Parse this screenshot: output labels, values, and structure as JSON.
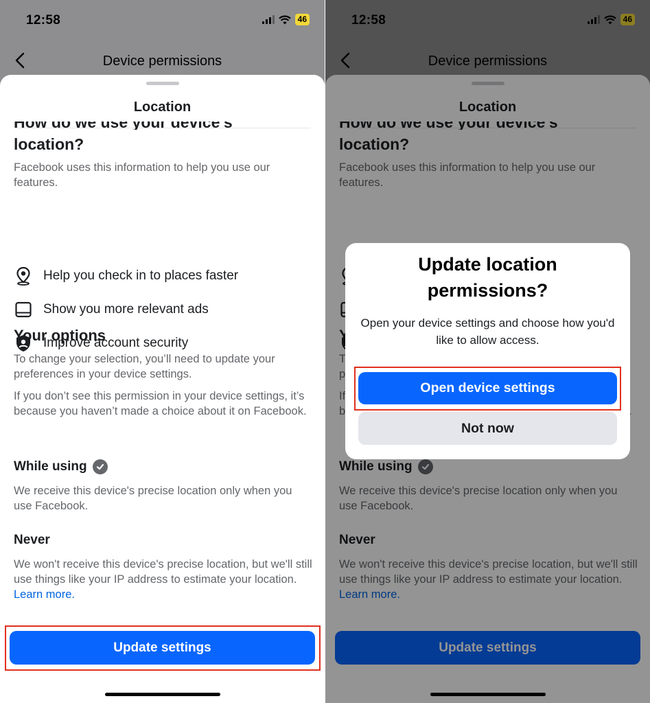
{
  "status": {
    "time": "12:58",
    "battery": "46"
  },
  "nav": {
    "title": "Device permissions"
  },
  "sheet": {
    "title": "Location",
    "cut_heading": "How do we use your device's",
    "heading": "location?",
    "intro": "Facebook uses this information to help you use our features.",
    "features": [
      {
        "icon": "location-pin-icon",
        "label": "Help you check in to places faster"
      },
      {
        "icon": "device-screen-icon",
        "label": "Show you more relevant ads"
      },
      {
        "icon": "shield-account-icon",
        "label": "Improve account security"
      }
    ],
    "options_heading": "Your options",
    "options_p1": "To change your selection, you’ll need to update your preferences in your device settings.",
    "options_p2": "If you don’t see this permission in your device settings, it’s because you haven’t made a choice about it on Facebook.",
    "while_using_heading": "While using",
    "while_using_text": "We receive this device's precise location only when you use Facebook.",
    "never_heading": "Never",
    "never_text": "We won't receive this device's precise location, but we'll still use things like your IP address to estimate your location.",
    "learn_more": "Learn more.",
    "update_button": "Update settings"
  },
  "dialog": {
    "title": "Update location permissions?",
    "text": "Open your device settings and choose how you'd like to allow access.",
    "primary": "Open device settings",
    "secondary": "Not now"
  },
  "colors": {
    "primary_blue": "#0866ff",
    "highlight_red": "#e0301e",
    "link_blue": "#0064e0"
  }
}
